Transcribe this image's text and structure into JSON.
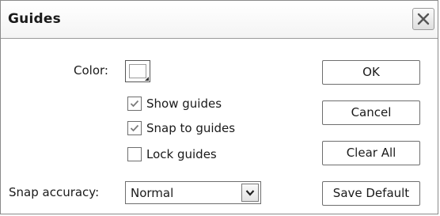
{
  "dialog": {
    "title": "Guides",
    "close_icon": "close-icon"
  },
  "color": {
    "label": "Color:",
    "swatch_color": "#ffffff"
  },
  "options": {
    "show_guides": {
      "label": "Show guides",
      "checked": true
    },
    "snap_to_guides": {
      "label": "Snap to guides",
      "checked": true
    },
    "lock_guides": {
      "label": "Lock guides",
      "checked": false
    }
  },
  "snap_accuracy": {
    "label": "Snap accuracy:",
    "value": "Normal"
  },
  "buttons": {
    "ok": "OK",
    "cancel": "Cancel",
    "clear_all": "Clear All",
    "save_default": "Save Default"
  }
}
